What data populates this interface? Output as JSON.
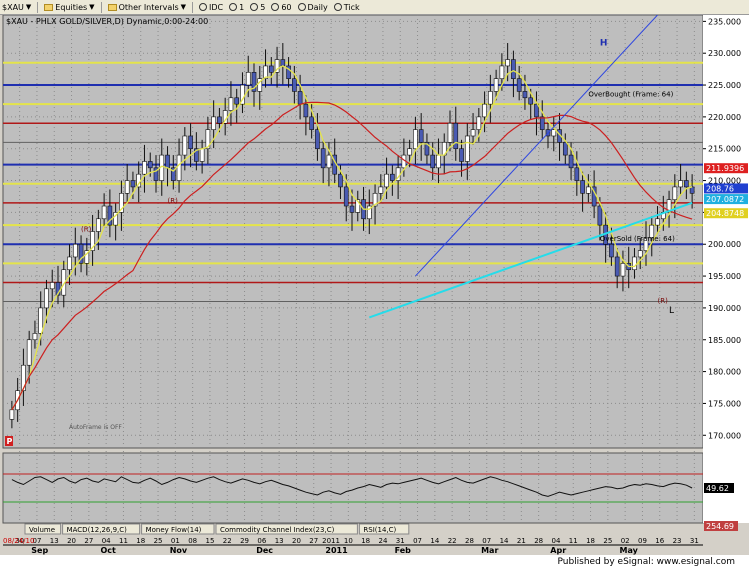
{
  "toolbar": {
    "symbol": "$XAU",
    "equities": "Equities",
    "other_intervals": "Other Intervals",
    "source": "IDC",
    "intervals": [
      "1",
      "5",
      "60",
      "Daily",
      "Tick"
    ]
  },
  "footer": "Published by eSignal: www.esignal.com",
  "colors": {
    "background": "#bebebe",
    "candle_fill": "#4a5bb3",
    "yellow_ma": "#e4e44a",
    "red_ma": "#cc2020",
    "trendline_cyan": "#25dcea",
    "trendline_blue": "#2f47e0"
  },
  "chart_data": {
    "type": "candlestick",
    "title": "$XAU - PHLX GOLD/SILVER,D) Dynamic,0:00-24:00",
    "ylim": [
      168,
      236
    ],
    "yticks": [
      170,
      175,
      180,
      185,
      190,
      195,
      200,
      205,
      210,
      215,
      220,
      225,
      230,
      235
    ],
    "x_day_labels": [
      "30",
      "07",
      "13",
      "20",
      "27",
      "04",
      "11",
      "18",
      "25",
      "01",
      "08",
      "15",
      "22",
      "29",
      "06",
      "13",
      "20",
      "27",
      "2011",
      "10",
      "18",
      "24",
      "31",
      "07",
      "14",
      "22",
      "28",
      "07",
      "14",
      "21",
      "28",
      "04",
      "11",
      "18",
      "25",
      "02",
      "09",
      "16",
      "23",
      "31"
    ],
    "first_date_label": "08/24/10",
    "month_labels": [
      "Sep",
      "Oct",
      "Nov",
      "Dec",
      "2011",
      "Feb",
      "Mar",
      "Apr",
      "May"
    ],
    "closes": [
      174,
      177,
      181,
      185,
      186,
      190,
      193,
      194,
      192,
      196,
      198,
      200,
      197,
      199,
      202,
      204,
      206,
      203,
      205,
      208,
      210,
      209,
      211,
      213,
      212,
      210,
      214,
      212,
      210,
      214,
      217,
      215,
      213,
      215,
      218,
      220,
      219,
      221,
      223,
      222,
      225,
      227,
      224,
      226,
      228,
      227,
      229,
      228,
      226,
      224,
      222,
      220,
      218,
      215,
      212,
      214,
      211,
      209,
      206,
      205,
      207,
      204,
      206,
      208,
      209,
      211,
      210,
      212,
      214,
      215,
      218,
      216,
      214,
      212,
      214,
      216,
      219,
      215,
      213,
      217,
      218,
      220,
      222,
      224,
      226,
      228,
      229,
      226,
      224,
      223,
      222,
      220,
      218,
      217,
      218,
      216,
      214,
      212,
      210,
      208,
      209,
      206,
      203,
      200,
      198,
      195,
      197,
      196,
      198,
      199,
      201,
      203,
      204,
      205,
      207,
      209,
      210,
      209,
      208
    ],
    "levels": {
      "yellow": [
        228.5,
        222,
        209.5,
        203,
        197
      ],
      "blue": [
        225,
        212.5,
        200
      ],
      "red": [
        219,
        206.5,
        194
      ],
      "gray": [
        216,
        191
      ]
    },
    "price_labels": [
      {
        "value": "211.9396",
        "y": 211.94,
        "color": "#dd2020"
      },
      {
        "value": "208.76",
        "y": 208.76,
        "color": "#2040d0"
      },
      {
        "value": "207.0872",
        "y": 207.09,
        "color": "#20b0e0"
      },
      {
        "value": "204.8748",
        "y": 204.87,
        "color": "#e0d020"
      }
    ],
    "annotations": [
      "OverBought (Frame: 64)",
      "OverSold (Frame: 64)",
      "AutoFrame is OFF",
      "(R)",
      "(R)",
      "H",
      "L",
      "(R)"
    ],
    "markers_low": [
      "P"
    ],
    "rsi": {
      "ylim": [
        0,
        100
      ],
      "upper": 70,
      "lower": 30,
      "last_value": "49.62",
      "last_price_label": "254.69",
      "values": [
        62,
        58,
        55,
        60,
        65,
        66,
        62,
        58,
        63,
        65,
        60,
        57,
        62,
        64,
        60,
        58,
        63,
        61,
        59,
        66,
        62,
        58,
        57,
        61,
        64,
        60,
        55,
        58,
        62,
        65,
        63,
        60,
        58,
        61,
        64,
        66,
        62,
        59,
        57,
        60,
        63,
        61,
        58,
        56,
        59,
        61,
        58,
        55,
        53,
        50,
        47,
        44,
        42,
        40,
        44,
        46,
        43,
        41,
        45,
        47,
        50,
        52,
        55,
        53,
        51,
        55,
        57,
        56,
        58,
        60,
        62,
        64,
        61,
        58,
        56,
        59,
        62,
        65,
        61,
        58,
        57,
        60,
        63,
        66,
        64,
        61,
        59,
        56,
        53,
        50,
        47,
        44,
        40,
        38,
        41,
        44,
        42,
        40,
        42,
        44,
        46,
        48,
        50,
        52,
        51,
        49,
        50,
        53,
        55,
        54,
        56,
        55,
        53,
        52,
        55,
        57,
        56,
        54,
        50
      ]
    },
    "indicator_tabs": [
      "Volume",
      "MACD(12,26,9,C)",
      "Money Flow(14)",
      "Commodity Channel Index(23,C)",
      "RSI(14,C)"
    ]
  }
}
